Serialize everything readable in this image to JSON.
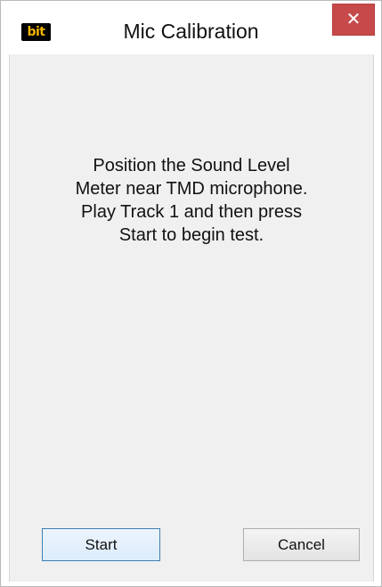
{
  "window": {
    "title": "Mic Calibration",
    "app_icon_text": "bit",
    "close_glyph": "✕"
  },
  "main": {
    "instruction_lines": [
      "Position the Sound Level",
      "Meter near TMD microphone.",
      "Play Track 1 and then press",
      "Start to begin test."
    ]
  },
  "buttons": {
    "start_label": "Start",
    "cancel_label": "Cancel"
  },
  "colors": {
    "close_button": "#c74a4a",
    "client_background": "#f0f0f0",
    "app_icon_text": "#f2b400"
  },
  "icons": {
    "app": "bit-logo-icon",
    "close": "close-icon"
  }
}
